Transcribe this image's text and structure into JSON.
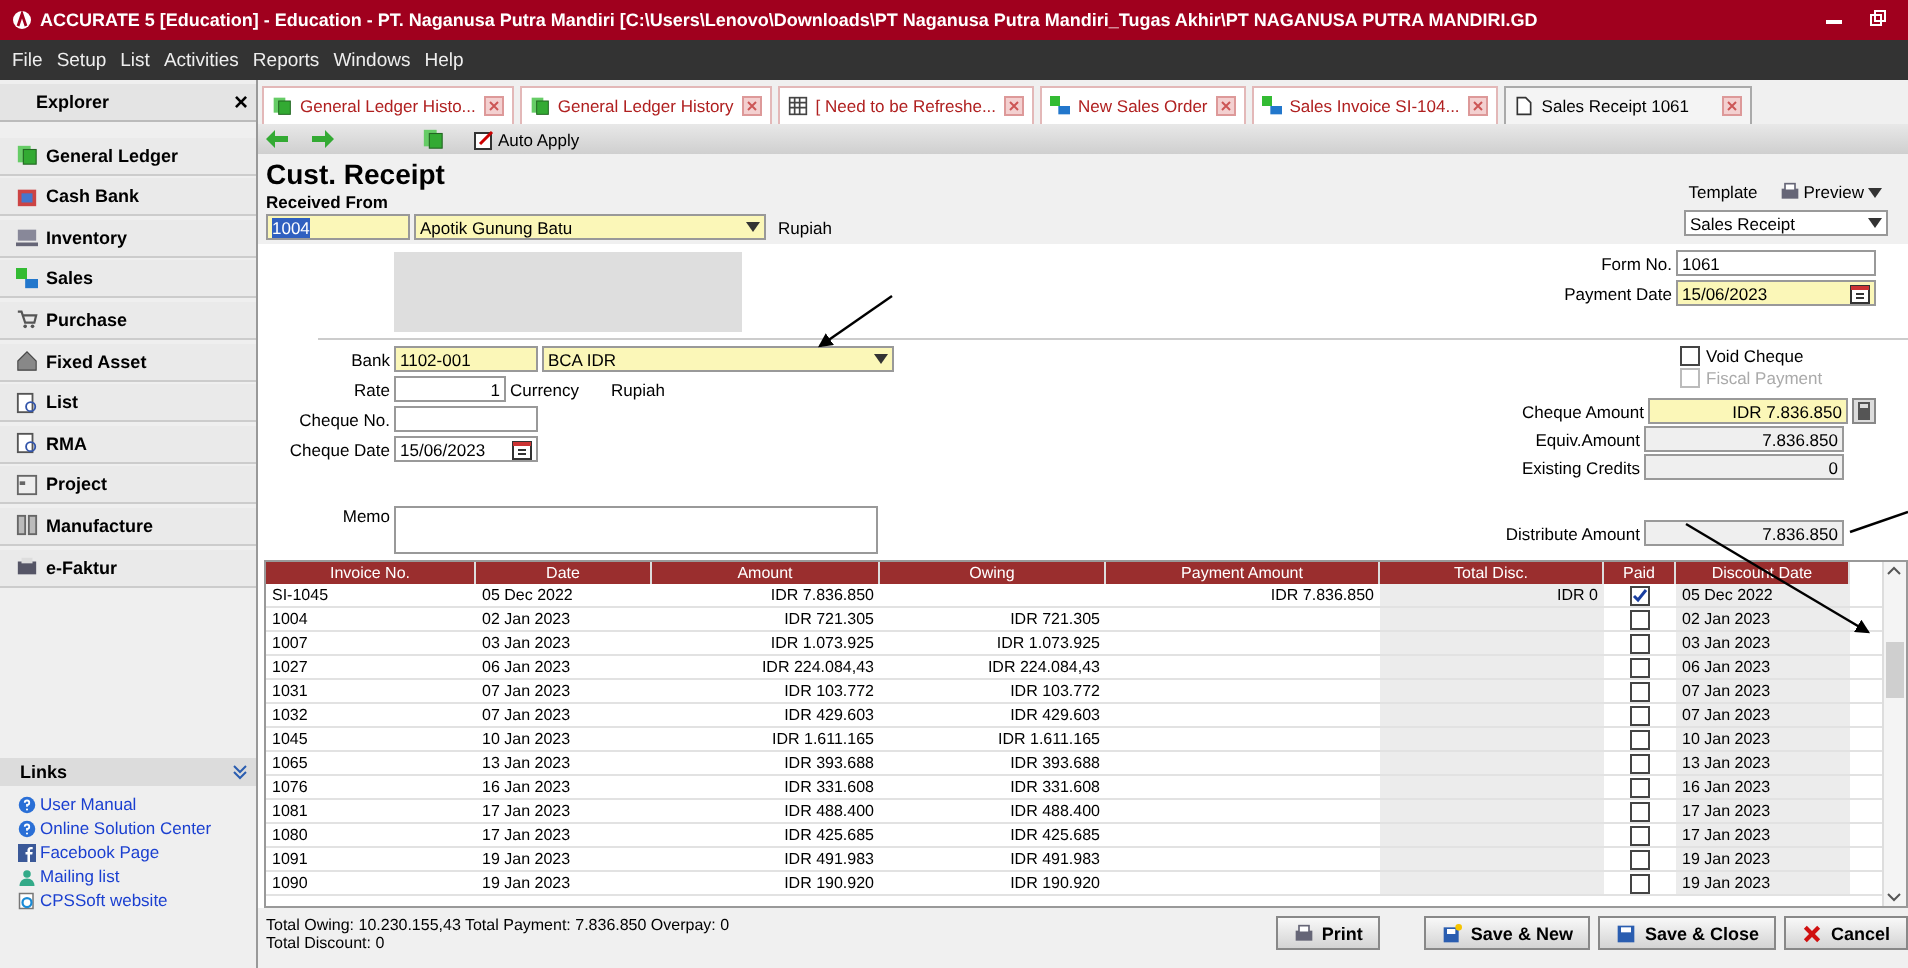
{
  "window": {
    "title": "ACCURATE 5 [Education] - Education - PT. Naganusa Putra Mandiri   [C:\\Users\\Lenovo\\Downloads\\PT Naganusa Putra Mandiri_Tugas Akhir\\PT NAGANUSA PUTRA MANDIRI.GD"
  },
  "menu": [
    "File",
    "Setup",
    "List",
    "Activities",
    "Reports",
    "Windows",
    "Help"
  ],
  "explorer": {
    "title": "Explorer",
    "close": "×",
    "items": [
      {
        "label": "General Ledger",
        "kind": "ledger"
      },
      {
        "label": "Cash Bank",
        "kind": "bank"
      },
      {
        "label": "Inventory",
        "kind": "inventory"
      },
      {
        "label": "Sales",
        "kind": "sales"
      },
      {
        "label": "Purchase",
        "kind": "cart"
      },
      {
        "label": "Fixed Asset",
        "kind": "house"
      },
      {
        "label": "List",
        "kind": "list"
      },
      {
        "label": "RMA",
        "kind": "list"
      },
      {
        "label": "Project",
        "kind": "project"
      },
      {
        "label": "Manufacture",
        "kind": "manufacture"
      },
      {
        "label": "e-Faktur",
        "kind": "faktur"
      }
    ]
  },
  "links": {
    "title": "Links",
    "items": [
      {
        "label": "User Manual",
        "kind": "help"
      },
      {
        "label": "Online Solution Center",
        "kind": "help"
      },
      {
        "label": "Facebook Page",
        "kind": "facebook"
      },
      {
        "label": "Mailing list",
        "kind": "mail"
      },
      {
        "label": "CPSSoft website",
        "kind": "web"
      }
    ]
  },
  "tabs": [
    {
      "label": "General Ledger Histo...",
      "kind": "ledger",
      "selected": false
    },
    {
      "label": "General Ledger History",
      "kind": "ledger",
      "selected": false
    },
    {
      "label": "[ Need to be Refreshe...",
      "kind": "grid",
      "selected": false
    },
    {
      "label": "New Sales Order",
      "kind": "sales",
      "selected": false
    },
    {
      "label": "Sales Invoice SI-104...",
      "kind": "sales",
      "selected": false
    },
    {
      "label": "Sales Receipt 1061",
      "kind": "doc",
      "selected": true
    }
  ],
  "toolbar": {
    "auto_apply": "Auto Apply"
  },
  "form": {
    "title": "Cust. Receipt",
    "received_from": "Received From",
    "customer_id": "1004",
    "customer_name": "Apotik Gunung Batu",
    "customer_currency": "Rupiah",
    "template_label": "Template",
    "preview": "Preview",
    "template": "Sales Receipt",
    "form_no_label": "Form No.",
    "form_no": "1061",
    "payment_date_label": "Payment Date",
    "payment_date": "15/06/2023",
    "bank_label": "Bank",
    "bank_id": "1102-001",
    "bank_name": "BCA IDR",
    "rate_label": "Rate",
    "rate": "1",
    "currency_label": "Currency",
    "currency": "Rupiah",
    "cheque_no_label": "Cheque No.",
    "cheque_date_label": "Cheque Date",
    "cheque_date": "15/06/2023",
    "memo_label": "Memo",
    "void_cheque": {
      "label": "Void Cheque",
      "checked": false,
      "disabled": false
    },
    "fiscal_payment": {
      "label": "Fiscal Payment",
      "checked": false,
      "disabled": true
    },
    "amounts": [
      {
        "label": "Cheque Amount",
        "value": "IDR 7.836.850",
        "kind": "editable"
      },
      {
        "label": "Equiv.Amount",
        "value": "7.836.850",
        "kind": "readonly"
      },
      {
        "label": "Existing Credits",
        "value": "0",
        "kind": "readonly"
      }
    ],
    "distribute_label": "Distribute Amount",
    "distribute": "7.836.850"
  },
  "table": {
    "columns": [
      "Invoice No.",
      "Date",
      "Amount",
      "Owing",
      "Payment Amount",
      "Total Disc.",
      "Paid",
      "Discount Date"
    ],
    "rows": [
      {
        "invoice": "SI-1045",
        "date": "05 Dec 2022",
        "amount": "IDR 7.836.850",
        "payment": "IDR 7.836.850",
        "disc": "IDR 0",
        "paid": true,
        "discount_date": "05 Dec 2022"
      },
      {
        "invoice": "1004",
        "date": "02 Jan 2023",
        "amount": "IDR 721.305",
        "owing": "IDR 721.305",
        "paid": false,
        "discount_date": "02 Jan 2023"
      },
      {
        "invoice": "1007",
        "date": "03 Jan 2023",
        "amount": "IDR 1.073.925",
        "owing": "IDR 1.073.925",
        "paid": false,
        "discount_date": "03 Jan 2023"
      },
      {
        "invoice": "1027",
        "date": "06 Jan 2023",
        "amount": "IDR 224.084,43",
        "owing": "IDR 224.084,43",
        "paid": false,
        "discount_date": "06 Jan 2023"
      },
      {
        "invoice": "1031",
        "date": "07 Jan 2023",
        "amount": "IDR 103.772",
        "owing": "IDR 103.772",
        "paid": false,
        "discount_date": "07 Jan 2023"
      },
      {
        "invoice": "1032",
        "date": "07 Jan 2023",
        "amount": "IDR 429.603",
        "owing": "IDR 429.603",
        "paid": false,
        "discount_date": "07 Jan 2023"
      },
      {
        "invoice": "1045",
        "date": "10 Jan 2023",
        "amount": "IDR 1.611.165",
        "owing": "IDR 1.611.165",
        "paid": false,
        "discount_date": "10 Jan 2023"
      },
      {
        "invoice": "1065",
        "date": "13 Jan 2023",
        "amount": "IDR 393.688",
        "owing": "IDR 393.688",
        "paid": false,
        "discount_date": "13 Jan 2023"
      },
      {
        "invoice": "1076",
        "date": "16 Jan 2023",
        "amount": "IDR 331.608",
        "owing": "IDR 331.608",
        "paid": false,
        "discount_date": "16 Jan 2023"
      },
      {
        "invoice": "1081",
        "date": "17 Jan 2023",
        "amount": "IDR 488.400",
        "owing": "IDR 488.400",
        "paid": false,
        "discount_date": "17 Jan 2023"
      },
      {
        "invoice": "1080",
        "date": "17 Jan 2023",
        "amount": "IDR 425.685",
        "owing": "IDR 425.685",
        "paid": false,
        "discount_date": "17 Jan 2023"
      },
      {
        "invoice": "1091",
        "date": "19 Jan 2023",
        "amount": "IDR 491.983",
        "owing": "IDR 491.983",
        "paid": false,
        "discount_date": "19 Jan 2023"
      },
      {
        "invoice": "1090",
        "date": "19 Jan 2023",
        "amount": "IDR 190.920",
        "owing": "IDR 190.920",
        "paid": false,
        "discount_date": "19 Jan 2023"
      }
    ]
  },
  "footer": {
    "totals": "Total Owing: 10.230.155,43   Total Payment: 7.836.850   Overpay: 0",
    "total_discount": "Total Discount: 0"
  },
  "buttons": [
    {
      "label": "Print",
      "kind": "print"
    },
    {
      "label": "Save & New",
      "kind": "save_new"
    },
    {
      "label": "Save & Close",
      "kind": "save_close"
    },
    {
      "label": "Cancel",
      "kind": "cancel"
    }
  ]
}
